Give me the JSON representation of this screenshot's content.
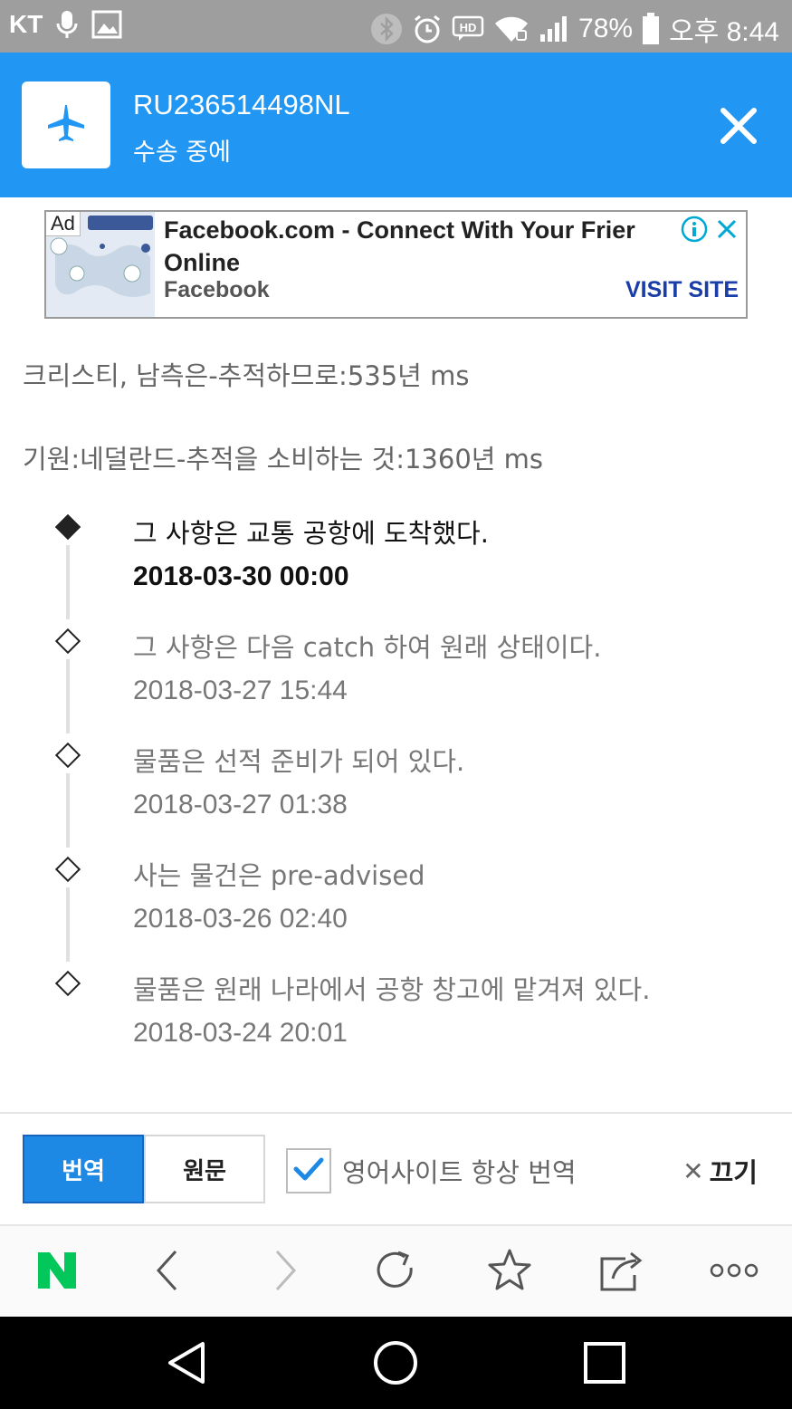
{
  "status_bar": {
    "carrier": "KT",
    "battery": "78%",
    "time": "오후 8:44"
  },
  "header": {
    "tracking_number": "RU236514498NL",
    "status": "수송 중에",
    "accent_color": "#2196f3"
  },
  "ad": {
    "label": "Ad",
    "title": "Facebook.com - Connect With Your Frier",
    "title_line2": "Online",
    "brand": "Facebook",
    "cta": "VISIT SITE"
  },
  "info": {
    "destination_line": "크리스티, 남측은-추적하므로:535년 ms",
    "origin_line": "기원:네덜란드-추적을 소비하는 것:1360년 ms"
  },
  "timeline": [
    {
      "title": "그 사항은 교통 공항에 도착했다.",
      "date": "2018-03-30 00:00",
      "current": true
    },
    {
      "title": "그 사항은 다음 catch 하여 원래 상태이다.",
      "date": "2018-03-27 15:44",
      "current": false
    },
    {
      "title": "물품은 선적 준비가 되어 있다.",
      "date": "2018-03-27 01:38",
      "current": false
    },
    {
      "title": "사는 물건은 pre-advised",
      "date": "2018-03-26 02:40",
      "current": false
    },
    {
      "title": "물품은 원래 나라에서 공항 창고에 맡겨져 있다.",
      "date": "2018-03-24 20:01",
      "current": false
    }
  ],
  "translate_bar": {
    "translate_label": "번역",
    "original_label": "원문",
    "always_translate_label": "영어사이트 항상 번역",
    "always_translate_checked": true,
    "turn_off_label": "끄기"
  },
  "browser_toolbar": {
    "icons": [
      "naver-n-icon",
      "back-icon",
      "forward-icon",
      "refresh-icon",
      "bookmark-star-icon",
      "share-icon",
      "more-icon"
    ],
    "brand_color": "#03c75a"
  },
  "nav_bar": {
    "icons": [
      "back-triangle-icon",
      "home-circle-icon",
      "recents-square-icon"
    ]
  }
}
